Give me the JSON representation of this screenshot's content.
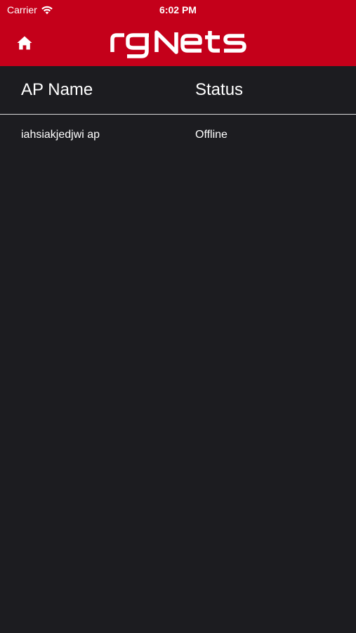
{
  "status_bar": {
    "carrier": "Carrier",
    "time": "6:02 PM",
    "wifi_icon": "wifi-icon"
  },
  "nav_bar": {
    "home_icon": "home-icon",
    "logo_text": "rgNets"
  },
  "colors": {
    "brand_red": "#c4001a",
    "background": "#1c1c20",
    "text": "#ffffff",
    "divider": "#d9d9d9"
  },
  "table": {
    "columns": [
      "AP Name",
      "Status"
    ],
    "rows": [
      {
        "name": "iahsiakjedjwi ap",
        "status": "Offline"
      }
    ]
  }
}
